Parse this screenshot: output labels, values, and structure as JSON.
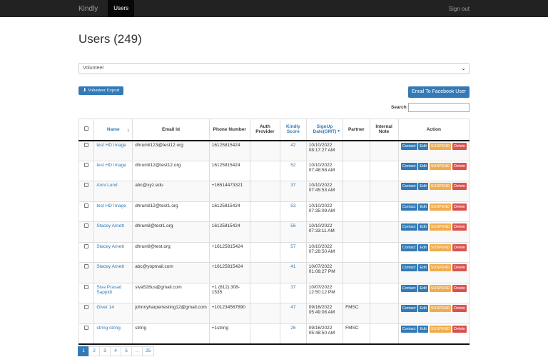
{
  "navbar": {
    "brand": "Kindly",
    "active_item": "Users",
    "signout": "Sign out"
  },
  "page": {
    "title": "Users (249)"
  },
  "filter": {
    "selected": "Volunteer"
  },
  "buttons": {
    "export": "Volunteer Export",
    "facebook": "Email To Facebook User"
  },
  "search": {
    "label": "Search",
    "value": ""
  },
  "table": {
    "headers": {
      "name": "Name",
      "email": "Email Id",
      "phone": "Phone Number",
      "auth": "Auth Provider",
      "score": "Kindly Score",
      "signup": "SignUp Date(GMT)",
      "partner": "Partner",
      "note": "Internal Note",
      "action": "Action"
    },
    "action_labels": {
      "contact": "Contact",
      "edit": "Edit",
      "suspend": "SUSPEND",
      "delete": "Delete"
    },
    "rows": [
      {
        "name": "test HD Image",
        "email": "dhrumil123@test12.org",
        "phone": "16125815424",
        "auth": "",
        "score": "42",
        "signup": "10/10/2022 08:17:27 AM",
        "partner": "",
        "note": ""
      },
      {
        "name": "test HD Image",
        "email": "dhrumil12@test12.org",
        "phone": "16125815424",
        "auth": "",
        "score": "52",
        "signup": "10/10/2022 07:48:58 AM",
        "partner": "",
        "note": ""
      },
      {
        "name": "Anni Lund",
        "email": "abc@xyz.edu",
        "phone": "+16514473321",
        "auth": "",
        "score": "37",
        "signup": "10/10/2022 07:45:53 AM",
        "partner": "",
        "note": ""
      },
      {
        "name": "test HD Image",
        "email": "dhrumil12@test1.org",
        "phone": "16125815424",
        "auth": "",
        "score": "53",
        "signup": "10/10/2022 07:35:09 AM",
        "partner": "",
        "note": ""
      },
      {
        "name": "Stacey Arnett",
        "email": "dhrumil@test1.org",
        "phone": "16125815424",
        "auth": "",
        "score": "56",
        "signup": "10/10/2022 07:33:11 AM",
        "partner": "",
        "note": ""
      },
      {
        "name": "Stacey Arnett",
        "email": "dhrumil@test.org",
        "phone": "+16125815424",
        "auth": "",
        "score": "57",
        "signup": "10/10/2022 07:28:50 AM",
        "partner": "",
        "note": ""
      },
      {
        "name": "Stacey Arnett",
        "email": "abc@yopmail.com",
        "phone": "+16125815424",
        "auth": "",
        "score": "41",
        "signup": "10/07/2022 01:08:27 PM",
        "partner": "",
        "note": ""
      },
      {
        "name": "Siva Prasad Sappidi",
        "email": "siva528us@gmail.com",
        "phone": "+1 (612) 308-1535",
        "auth": "",
        "score": "37",
        "signup": "10/07/2022 12:50:12 PM",
        "partner": "",
        "note": ""
      },
      {
        "name": "Giver 14",
        "email": "johnnyharpertesting12@gmail.com",
        "phone": "+101234567890",
        "auth": "",
        "score": "47",
        "signup": "09/16/2022 05:49:08 AM",
        "partner": "FMSC",
        "note": ""
      },
      {
        "name": "string string",
        "email": "string",
        "phone": "+1string",
        "auth": "",
        "score": "26",
        "signup": "09/16/2022 05:48:50 AM",
        "partner": "FMSC",
        "note": ""
      }
    ]
  },
  "pagination": [
    "1",
    "2",
    "3",
    "4",
    "5",
    "...",
    "25"
  ],
  "pagination_active": "1",
  "colors": {
    "primary": "#337ab7",
    "warning": "#f0ad4e",
    "danger": "#d9534f",
    "navbar": "#222222"
  }
}
